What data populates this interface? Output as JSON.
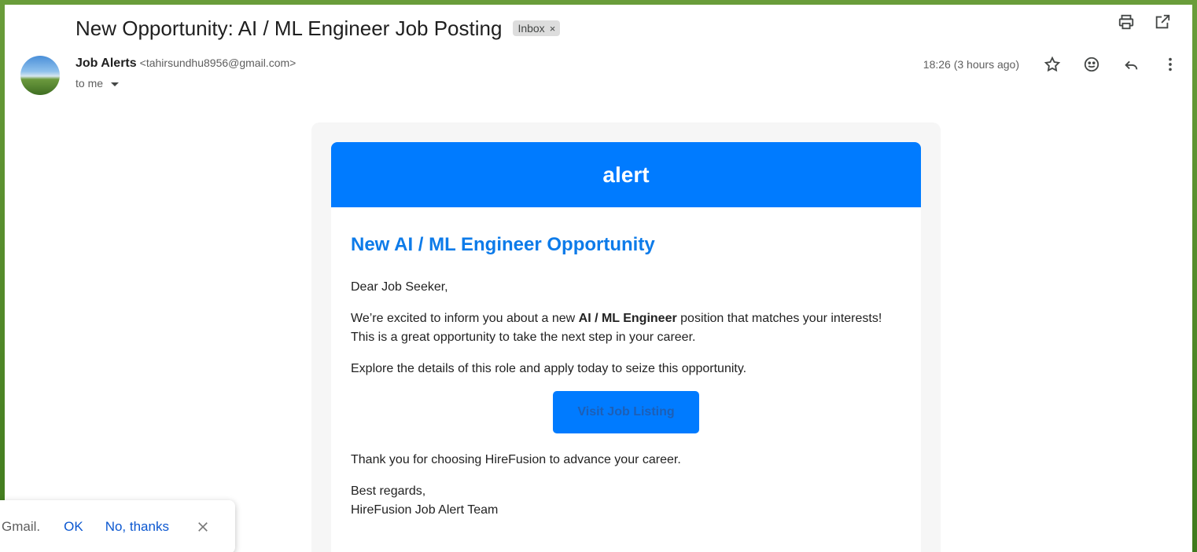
{
  "email": {
    "subject": "New Opportunity: AI / ML Engineer Job Posting",
    "label": "Inbox",
    "label_remove": "×",
    "sender_name": "Job Alerts",
    "sender_email": "<tahirsundhu8956@gmail.com>",
    "recipient": "to me",
    "time": "18:26 (3 hours ago)"
  },
  "icons": {
    "print": "print-icon",
    "open_new_window": "open-in-new-window-icon",
    "star": "star-icon",
    "emoji": "emoji-reaction-icon",
    "reply": "reply-icon",
    "more": "more-vert-icon"
  },
  "body": {
    "header": "alert",
    "title": "New AI / ML Engineer Opportunity",
    "greeting": "Dear Job Seeker,",
    "intro_before": "We’re excited to inform you about a new ",
    "intro_bold": "AI / ML Engineer",
    "intro_after": " position that matches your interests! This is a great opportunity to take the next step in your career.",
    "explore": "Explore the details of this role and apply today to seize this opportunity.",
    "button": "Visit Job Listing",
    "thanks": "Thank you for choosing HireFusion to advance your career.",
    "regards": "Best regards,",
    "signature": "HireFusion Job Alert Team"
  },
  "toast": {
    "text": "Gmail.",
    "ok": "OK",
    "no": "No, thanks"
  },
  "colors": {
    "header_blue": "#007bff",
    "title_blue": "#0d7be9",
    "link_blue": "#0b57d0"
  }
}
